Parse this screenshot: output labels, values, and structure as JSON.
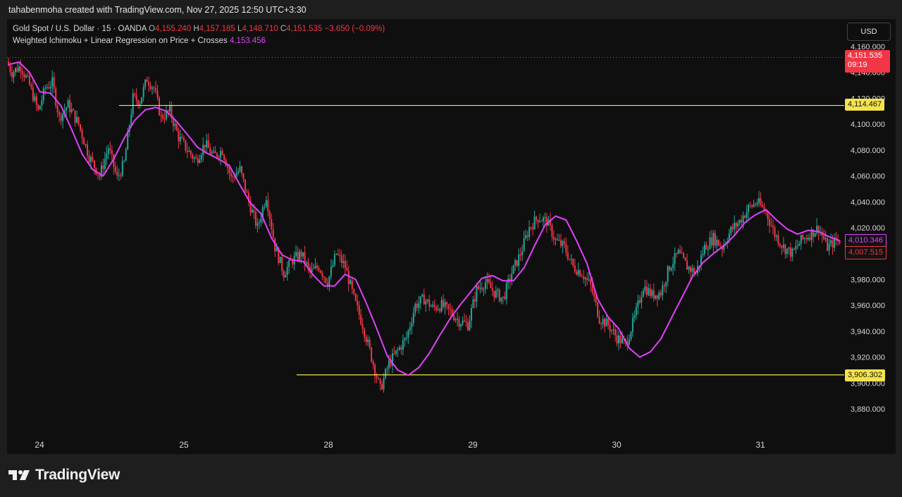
{
  "header": {
    "attribution": "tahabenmoha created with TradingView.com, Nov 27, 2025 12:50 UTC+3:30"
  },
  "legend": {
    "symbol": "Gold Spot / U.S. Dollar · 15 · OANDA",
    "o_label": "O",
    "o": "4,155.240",
    "h_label": "H",
    "h": "4,157.185",
    "l_label": "L",
    "l": "4,148.710",
    "c_label": "C",
    "c": "4,151.535",
    "change": "−3.650 (−0.09%)",
    "indicator": "Weighted Ichimoku + Linear Regression on Price + Crosses",
    "indicator_value": "4,153.456"
  },
  "currency": "USD",
  "price_tags": {
    "last_price": "4,151.535",
    "countdown": "09:19",
    "resistance": "4,114.467",
    "support": "3,906.302",
    "ichimoku": "4,010.346",
    "regression": "4,007.515"
  },
  "footer": {
    "brand": "TradingView"
  },
  "colors": {
    "up": "#26a69a",
    "down": "#f23645",
    "indicator": "#e040fb",
    "levels": "#f5e34b",
    "background": "#0f0f0f"
  },
  "chart_data": {
    "type": "candlestick",
    "ylim": [
      3870,
      4165
    ],
    "y_ticks": [
      "3,880.000",
      "3,900.000",
      "3,920.000",
      "3,940.000",
      "3,960.000",
      "3,980.000",
      "4,000.000",
      "4,020.000",
      "4,040.000",
      "4,060.000",
      "4,080.000",
      "4,100.000",
      "4,120.000",
      "4,140.000",
      "4,160.000"
    ],
    "x_ticks": [
      "24",
      "25",
      "28",
      "29",
      "30",
      "31"
    ],
    "horizontal_levels": [
      {
        "name": "resistance",
        "value": 4114.467
      },
      {
        "name": "support",
        "value": 3906.302
      }
    ],
    "last_price_line": 4151.535,
    "price_path": [
      [
        0,
        4148
      ],
      [
        3,
        4140
      ],
      [
        8,
        4145
      ],
      [
        13,
        4130
      ],
      [
        18,
        4110
      ],
      [
        22,
        4128
      ],
      [
        26,
        4132
      ],
      [
        30,
        4105
      ],
      [
        35,
        4115
      ],
      [
        41,
        4100
      ],
      [
        47,
        4075
      ],
      [
        53,
        4060
      ],
      [
        58,
        4082
      ],
      [
        63,
        4058
      ],
      [
        67,
        4070
      ],
      [
        72,
        4120
      ],
      [
        76,
        4118
      ],
      [
        80,
        4135
      ],
      [
        84,
        4128
      ],
      [
        88,
        4105
      ],
      [
        93,
        4110
      ],
      [
        98,
        4090
      ],
      [
        103,
        4080
      ],
      [
        108,
        4072
      ],
      [
        113,
        4085
      ],
      [
        118,
        4075
      ],
      [
        123,
        4080
      ],
      [
        128,
        4058
      ],
      [
        133,
        4065
      ],
      [
        138,
        4040
      ],
      [
        143,
        4020
      ],
      [
        148,
        4045
      ],
      [
        153,
        4005
      ],
      [
        158,
        3985
      ],
      [
        163,
        3995
      ],
      [
        168,
        4000
      ],
      [
        173,
        3985
      ],
      [
        178,
        3990
      ],
      [
        183,
        3978
      ],
      [
        188,
        4000
      ],
      [
        193,
        3990
      ],
      [
        198,
        3965
      ],
      [
        203,
        3945
      ],
      [
        208,
        3920
      ],
      [
        213,
        3895
      ],
      [
        218,
        3915
      ],
      [
        223,
        3925
      ],
      [
        228,
        3935
      ],
      [
        233,
        3960
      ],
      [
        238,
        3965
      ],
      [
        243,
        3958
      ],
      [
        248,
        3960
      ],
      [
        253,
        3955
      ],
      [
        258,
        3948
      ],
      [
        263,
        3945
      ],
      [
        268,
        3972
      ],
      [
        273,
        3978
      ],
      [
        278,
        3970
      ],
      [
        283,
        3965
      ],
      [
        288,
        3985
      ],
      [
        293,
        4000
      ],
      [
        298,
        4020
      ],
      [
        303,
        4028
      ],
      [
        308,
        4025
      ],
      [
        313,
        4010
      ],
      [
        318,
        4005
      ],
      [
        323,
        3990
      ],
      [
        328,
        3985
      ],
      [
        333,
        3975
      ],
      [
        338,
        3950
      ],
      [
        343,
        3945
      ],
      [
        348,
        3935
      ],
      [
        353,
        3930
      ],
      [
        358,
        3950
      ],
      [
        363,
        3975
      ],
      [
        368,
        3968
      ],
      [
        373,
        3970
      ],
      [
        378,
        3990
      ],
      [
        383,
        4000
      ],
      [
        388,
        3990
      ],
      [
        393,
        3985
      ],
      [
        398,
        4005
      ],
      [
        403,
        4012
      ],
      [
        408,
        4005
      ],
      [
        413,
        4018
      ],
      [
        418,
        4025
      ],
      [
        423,
        4035
      ],
      [
        428,
        4040
      ],
      [
        433,
        4032
      ],
      [
        438,
        4015
      ],
      [
        443,
        4005
      ],
      [
        448,
        4000
      ],
      [
        453,
        4010
      ],
      [
        458,
        4015
      ],
      [
        463,
        4020
      ],
      [
        468,
        4005
      ],
      [
        473,
        4010
      ]
    ],
    "ichimoku_path": [
      [
        0,
        4146
      ],
      [
        6,
        4148
      ],
      [
        12,
        4140
      ],
      [
        18,
        4125
      ],
      [
        24,
        4124
      ],
      [
        30,
        4114
      ],
      [
        36,
        4096
      ],
      [
        42,
        4077
      ],
      [
        48,
        4065
      ],
      [
        54,
        4060
      ],
      [
        60,
        4073
      ],
      [
        66,
        4089
      ],
      [
        72,
        4103
      ],
      [
        78,
        4111
      ],
      [
        84,
        4113
      ],
      [
        90,
        4110
      ],
      [
        96,
        4102
      ],
      [
        102,
        4092
      ],
      [
        108,
        4082
      ],
      [
        114,
        4077
      ],
      [
        120,
        4073
      ],
      [
        126,
        4068
      ],
      [
        132,
        4053
      ],
      [
        138,
        4039
      ],
      [
        144,
        4031
      ],
      [
        150,
        4012
      ],
      [
        156,
        3999
      ],
      [
        162,
        3995
      ],
      [
        168,
        3994
      ],
      [
        174,
        3983
      ],
      [
        180,
        3975
      ],
      [
        186,
        3975
      ],
      [
        192,
        3984
      ],
      [
        198,
        3980
      ],
      [
        204,
        3962
      ],
      [
        210,
        3942
      ],
      [
        216,
        3921
      ],
      [
        222,
        3910
      ],
      [
        228,
        3906
      ],
      [
        234,
        3912
      ],
      [
        240,
        3923
      ],
      [
        246,
        3937
      ],
      [
        252,
        3950
      ],
      [
        258,
        3961
      ],
      [
        264,
        3971
      ],
      [
        270,
        3981
      ],
      [
        276,
        3983
      ],
      [
        282,
        3979
      ],
      [
        288,
        3979
      ],
      [
        294,
        3989
      ],
      [
        300,
        4006
      ],
      [
        306,
        4022
      ],
      [
        312,
        4029
      ],
      [
        318,
        4026
      ],
      [
        324,
        4010
      ],
      [
        330,
        3992
      ],
      [
        336,
        3965
      ],
      [
        342,
        3951
      ],
      [
        348,
        3942
      ],
      [
        354,
        3927
      ],
      [
        360,
        3920
      ],
      [
        366,
        3924
      ],
      [
        372,
        3934
      ],
      [
        378,
        3950
      ],
      [
        384,
        3966
      ],
      [
        390,
        3982
      ],
      [
        396,
        3993
      ],
      [
        402,
        4000
      ],
      [
        408,
        4006
      ],
      [
        414,
        4014
      ],
      [
        420,
        4024
      ],
      [
        426,
        4030
      ],
      [
        432,
        4034
      ],
      [
        438,
        4026
      ],
      [
        444,
        4019
      ],
      [
        450,
        4015
      ],
      [
        456,
        4018
      ],
      [
        462,
        4017
      ],
      [
        468,
        4013
      ],
      [
        474,
        4010
      ]
    ]
  }
}
